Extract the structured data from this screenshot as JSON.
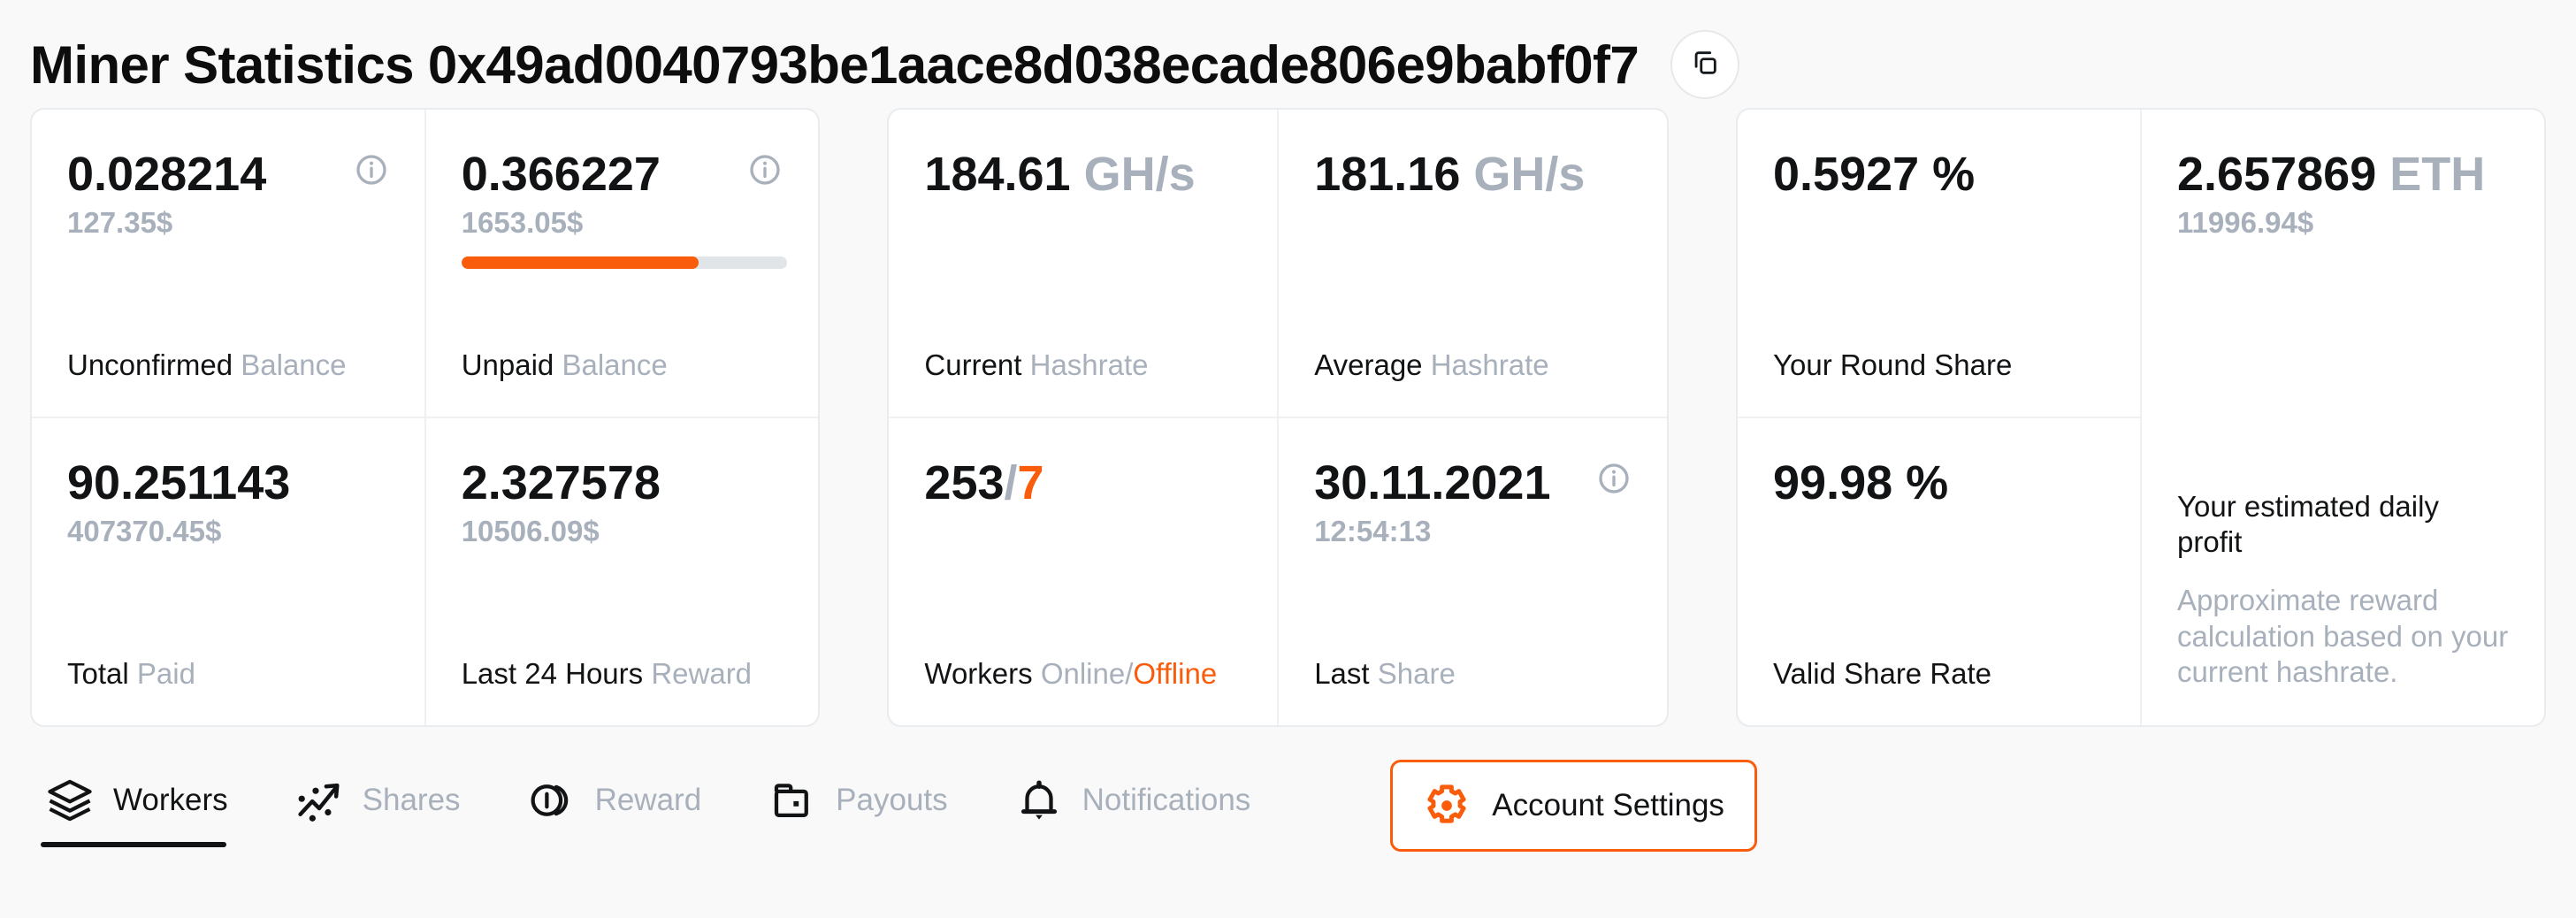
{
  "header": {
    "title": "Miner Statistics 0x49ad0040793be1aace8d038ecade806e9babf0f7",
    "copy_icon": "copy-icon"
  },
  "colors": {
    "accent": "#f95c0a",
    "muted": "#a7b0bb",
    "text": "#111315",
    "card_border": "#e9ecef",
    "page_bg": "#f9f9f9"
  },
  "cards": {
    "balances": {
      "unconfirmed": {
        "value": "0.028214",
        "fiat": "127.35$",
        "caption_strong": "Unconfirmed",
        "caption_muted": "Balance",
        "info_icon": "info-icon"
      },
      "unpaid": {
        "value": "0.366227",
        "fiat": "1653.05$",
        "progress_percent": 73,
        "caption_strong": "Unpaid",
        "caption_muted": "Balance",
        "info_icon": "info-icon"
      },
      "total_paid": {
        "value": "90.251143",
        "fiat": "407370.45$",
        "caption_strong": "Total",
        "caption_muted": "Paid"
      },
      "last24_reward": {
        "value": "2.327578",
        "fiat": "10506.09$",
        "caption_strong": "Last 24 Hours",
        "caption_muted": "Reward"
      }
    },
    "hashrate": {
      "current": {
        "value": "184.61",
        "unit": "GH/s",
        "caption_strong": "Current",
        "caption_muted": "Hashrate"
      },
      "average": {
        "value": "181.16",
        "unit": "GH/s",
        "caption_strong": "Average",
        "caption_muted": "Hashrate"
      },
      "workers": {
        "online": "253",
        "separator": "/",
        "offline": "7",
        "caption_strong": "Workers",
        "caption_muted": "Online",
        "caption_sep": "/",
        "caption_accent": "Offline"
      },
      "last_share": {
        "date": "30.11.2021",
        "time": "12:54:13",
        "caption_strong": "Last",
        "caption_muted": "Share",
        "info_icon": "info-icon"
      }
    },
    "share": {
      "round_share": {
        "value": "0.5927 %",
        "caption_strong": "Your Round Share"
      },
      "valid_share_rate": {
        "value": "99.98 %",
        "caption_strong": "Valid Share Rate"
      },
      "daily_profit": {
        "value": "2.657869",
        "unit": "ETH",
        "fiat": "11996.94$",
        "note_title": "Your estimated daily profit",
        "note_body": "Approximate reward calculation based on your current hashrate."
      }
    }
  },
  "tabs": [
    {
      "label": "Workers",
      "icon": "layers-icon",
      "active": true
    },
    {
      "label": "Shares",
      "icon": "trending-dots-icon",
      "active": false
    },
    {
      "label": "Reward",
      "icon": "coins-icon",
      "active": false
    },
    {
      "label": "Payouts",
      "icon": "wallet-icon",
      "active": false
    },
    {
      "label": "Notifications",
      "icon": "bell-icon",
      "active": false
    }
  ],
  "settings_button": {
    "label": "Account Settings",
    "icon": "gear-icon"
  }
}
